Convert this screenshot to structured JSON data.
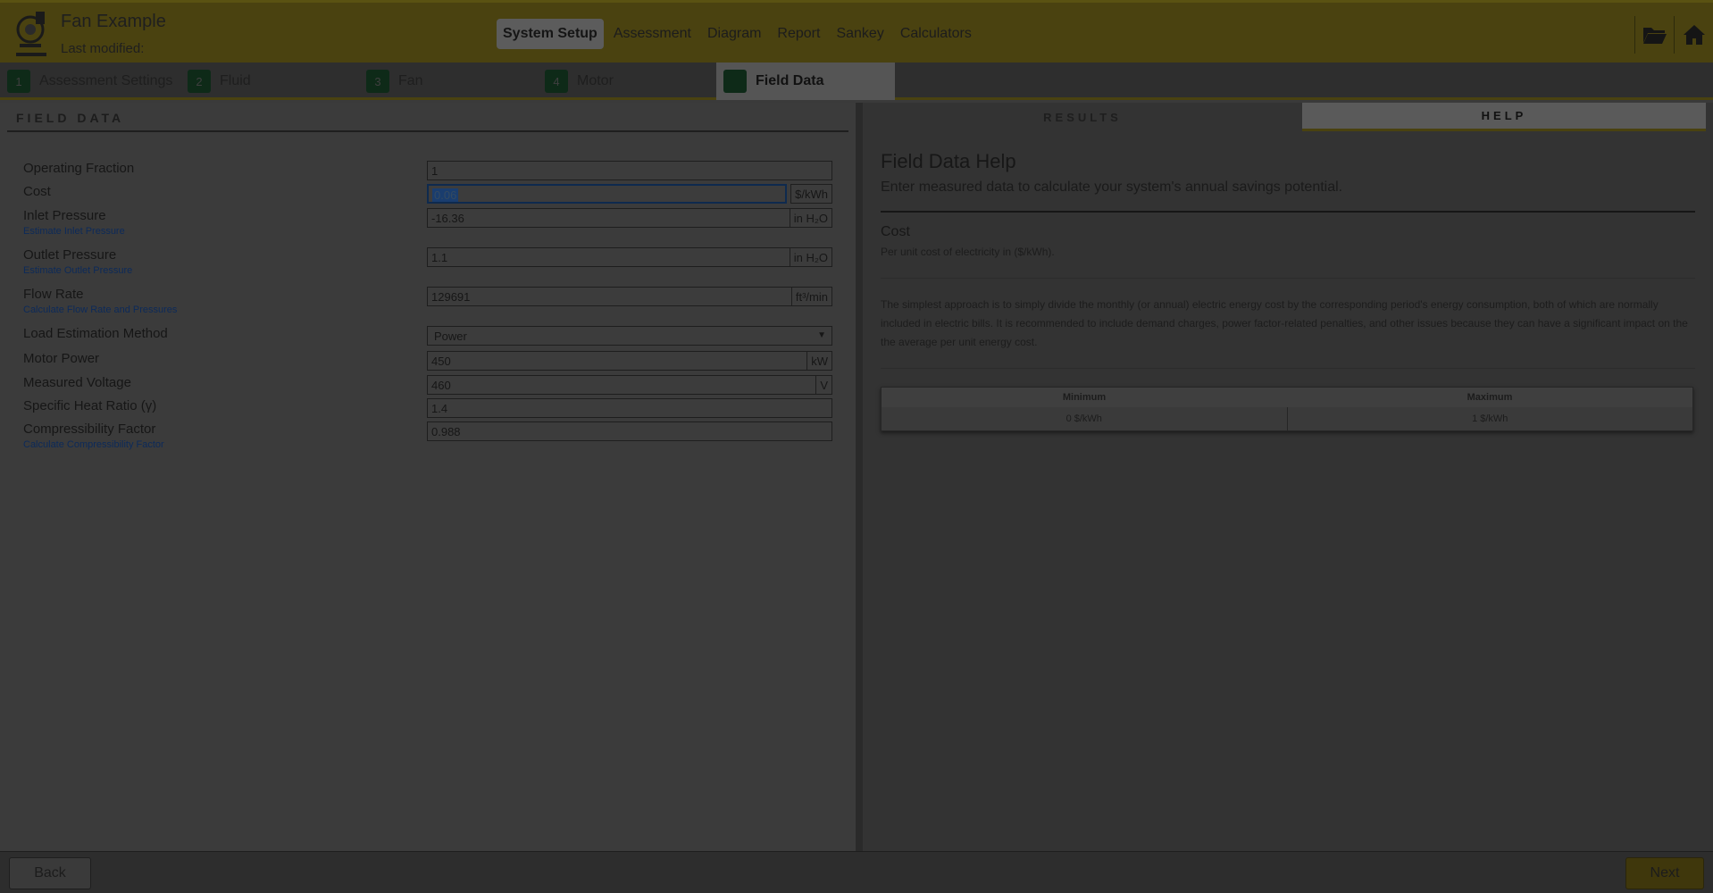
{
  "header": {
    "title": "Fan Example",
    "subtitle": "Last modified:",
    "nav": [
      "System Setup",
      "Assessment",
      "Diagram",
      "Report",
      "Sankey",
      "Calculators"
    ],
    "active_nav": "System Setup",
    "icons": [
      "folder-open-icon",
      "home-icon"
    ]
  },
  "steps": [
    {
      "num": "1",
      "label": "Assessment Settings"
    },
    {
      "num": "2",
      "label": "Fluid"
    },
    {
      "num": "3",
      "label": "Fan"
    },
    {
      "num": "4",
      "label": "Motor"
    },
    {
      "num": "",
      "label": "Field Data"
    }
  ],
  "left_panel": {
    "title": "FIELD DATA",
    "fields": {
      "operating_fraction": {
        "label": "Operating Fraction",
        "value": "1"
      },
      "cost": {
        "label": "Cost",
        "value": "0.06",
        "unit": "$/kWh"
      },
      "inlet_pressure": {
        "label": "Inlet Pressure",
        "value": "-16.36",
        "unit": "in H₂O",
        "link": "Estimate Inlet Pressure"
      },
      "outlet_pressure": {
        "label": "Outlet Pressure",
        "value": "1.1",
        "unit": "in H₂O",
        "link": "Estimate Outlet Pressure"
      },
      "flow_rate": {
        "label": "Flow Rate",
        "value": "129691",
        "unit": "ft³/min",
        "link": "Calculate Flow Rate and Pressures"
      },
      "load_estimation": {
        "label": "Load Estimation Method",
        "value": "Power"
      },
      "motor_power": {
        "label": "Motor Power",
        "value": "450",
        "unit": "kW"
      },
      "measured_voltage": {
        "label": "Measured Voltage",
        "value": "460",
        "unit": "V"
      },
      "specific_heat": {
        "label": "Specific Heat Ratio (γ)",
        "value": "1.4"
      },
      "compressibility": {
        "label": "Compressibility Factor",
        "value": "0.988",
        "link": "Calculate Compressibility Factor"
      }
    }
  },
  "right_panel": {
    "tabs": [
      "RESULTS",
      "HELP"
    ],
    "active_tab": "HELP",
    "help_title": "Field Data Help",
    "help_subtitle": "Enter measured data to calculate your system's annual savings potential.",
    "section_title": "Cost",
    "section_desc": "Per unit cost of electricity in ($/kWh).",
    "section_long": "The simplest approach is to simply divide the monthly (or annual) electric energy cost by the corresponding period's energy consumption, both of which are normally included in electric bills. It is recommended to include demand charges, power factor-related penalties, and other issues because they can have a significant impact on the the average per unit energy cost.",
    "range": {
      "min_label": "Minimum",
      "max_label": "Maximum",
      "min_value": "0 $/kWh",
      "max_value": "1 $/kWh"
    }
  },
  "footer": {
    "back_label": "Back",
    "next_label": "Next"
  },
  "colors": {
    "header_bg": "#4a4210",
    "step_badge": "#0e2a18",
    "link": "#0c2a5a",
    "focus": "#0e2a4e"
  }
}
